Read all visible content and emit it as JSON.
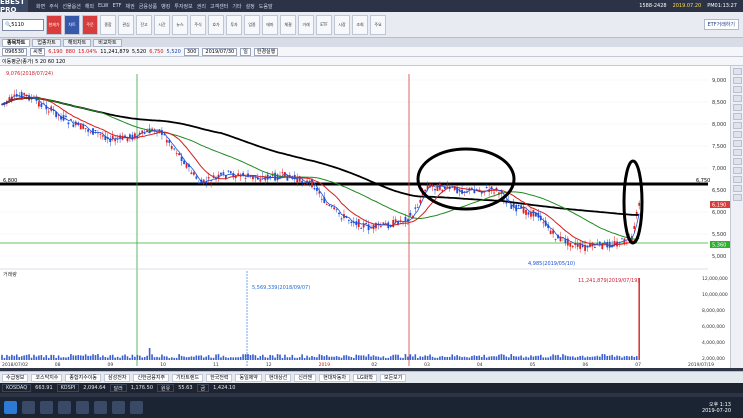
{
  "window": {
    "logo": "EBEST PRO",
    "menu": [
      "화면",
      "주식",
      "선물옵션",
      "해외",
      "ELW",
      "ETF",
      "채권",
      "금융상품",
      "뱅킹",
      "투자정보",
      "권리",
      "고객센터",
      "기타",
      "설정",
      "도움말"
    ],
    "date": "2019.07.20",
    "time": "PM01:13:27",
    "phone": "1588-2428"
  },
  "toolbar": {
    "search_value": "5110",
    "buttons": [
      "현재가",
      "차트",
      "주문",
      "종합",
      "관심",
      "잔고",
      "시간",
      "뉴스",
      "주식",
      "호가",
      "투자",
      "업종",
      "테마",
      "체결",
      "거래",
      "ETF",
      "시장",
      "조회",
      "주요"
    ],
    "etf_link": "ETF거래하기"
  },
  "tabs": [
    "종목차트",
    "업종차트",
    "해외차트",
    "비교차트"
  ],
  "controls": {
    "code": "096530",
    "name": "씨젠",
    "price": "6,190",
    "change": "880",
    "pct": "15.04%",
    "volume": "11,241,879",
    "open": "5,520",
    "high": "6,750",
    "low": "5,520",
    "period_select": "일",
    "date_from": "2019/07/30",
    "apply": "한경실행",
    "count": "300"
  },
  "chart": {
    "title": "이동평균(종가) 5 20 60 120",
    "price_levels": [
      "9,000",
      "8,500",
      "8,000",
      "7,500",
      "7,000",
      "6,500",
      "6,000",
      "5,500",
      "5,000"
    ],
    "volume_levels": [
      "12,000,000",
      "10,000,000",
      "8,000,000",
      "6,000,000",
      "4,000,000",
      "2,000,000"
    ],
    "annotations": {
      "high": "9,076(2018/07/24)",
      "low": "4,985(2019/05/10)",
      "vol_spike": "11,241,879(2019/07/19)",
      "vol_mid": "5,569,339(2018/09/07)",
      "ref_line": "6,800",
      "cur_price": "6,190",
      "right_tag": "6,750",
      "support": "5,360"
    },
    "x_ticks": [
      "2018/07/02",
      "08",
      "09",
      "10",
      "11",
      "12",
      "2019",
      "02",
      "03",
      "04",
      "05",
      "06",
      "07",
      "2019/07/19"
    ],
    "vol_label": "거래량"
  },
  "indicators": {
    "items": [
      "수급정보",
      "코스닥지수",
      "종합지수이동",
      "삼성전자",
      "신한금융지주",
      "기타트렌드",
      "한국전력",
      "동일제약",
      "현대상선",
      "신라젠",
      "현대자동차",
      "LG화학",
      "모든보기"
    ]
  },
  "ticker": {
    "items": [
      "KOSDAQ",
      "663.91",
      "KOSPI",
      "2,094.64",
      "달러",
      "1,176.50",
      "원유",
      "55.63",
      "금",
      "1,424.10"
    ]
  },
  "taskbar": {
    "time": "오후 1:13",
    "date": "2019-07-20"
  },
  "colors": {
    "ma5": "#d81e1e",
    "ma20": "#1f8a1f",
    "ma60": "#000000",
    "ma120": "#7a7a7a",
    "candle_up": "#e02020",
    "candle_down": "#1b4fd8",
    "ref": "#000000"
  }
}
